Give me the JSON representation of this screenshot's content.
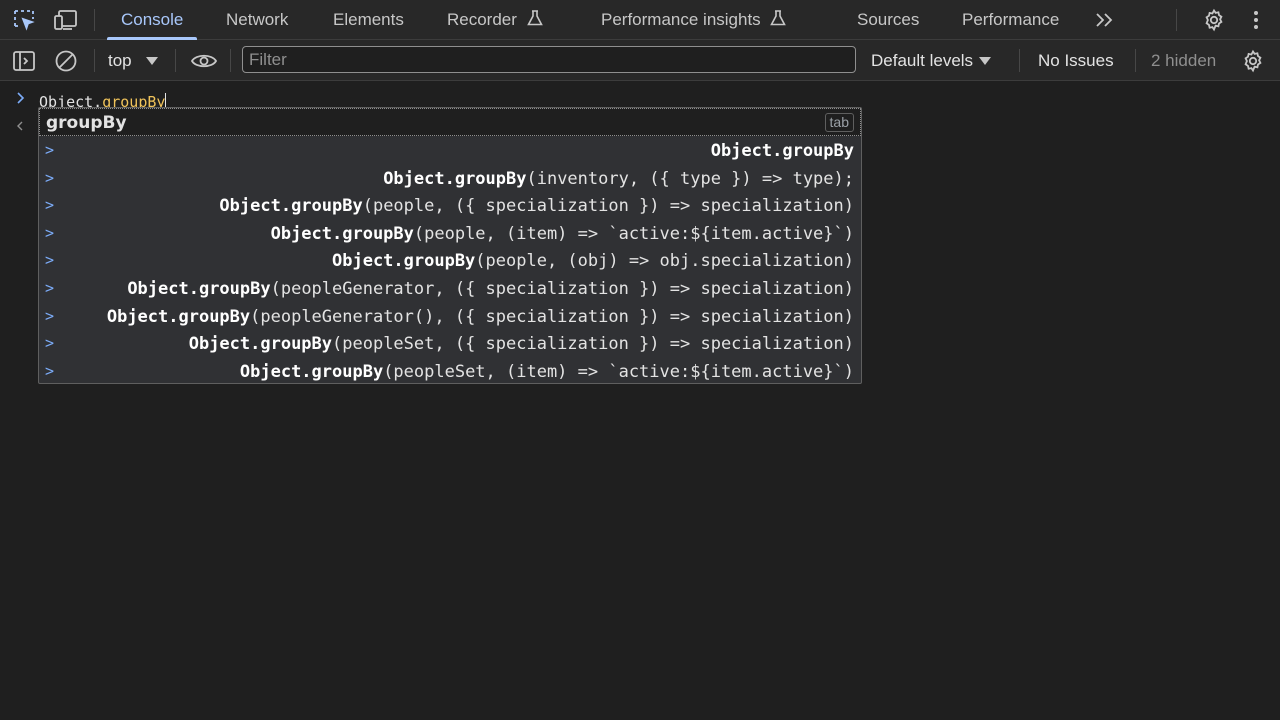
{
  "tabs": [
    {
      "label": "Console",
      "active": true
    },
    {
      "label": "Network"
    },
    {
      "label": "Elements"
    },
    {
      "label": "Recorder"
    },
    {
      "label": "Performance insights"
    },
    {
      "label": "Sources"
    },
    {
      "label": "Performance"
    }
  ],
  "toolbar": {
    "context": "top",
    "filter_placeholder": "Filter",
    "levels": "Default levels",
    "issues": "No Issues",
    "hidden": "2 hidden"
  },
  "console": {
    "input_prefix": "Object.",
    "input_keyword": "groupBy"
  },
  "autocomplete": {
    "header": "groupBy",
    "tab_hint": "tab",
    "arrow": ">",
    "suggestions": [
      {
        "bold": "Object.groupBy",
        "rest": ""
      },
      {
        "bold": "Object.groupBy",
        "rest": "(inventory, ({ type }) => type);"
      },
      {
        "bold": "Object.groupBy",
        "rest": "(people, ({ specialization }) => specialization)"
      },
      {
        "bold": "Object.groupBy",
        "rest": "(people, (item) => `active:${item.active}`)"
      },
      {
        "bold": "Object.groupBy",
        "rest": "(people, (obj) => obj.specialization)"
      },
      {
        "bold": "Object.groupBy",
        "rest": "(peopleGenerator, ({ specialization }) => specialization)"
      },
      {
        "bold": "Object.groupBy",
        "rest": "(peopleGenerator(), ({ specialization }) => specialization)"
      },
      {
        "bold": "Object.groupBy",
        "rest": "(peopleSet, ({ specialization }) => specialization)"
      },
      {
        "bold": "Object.groupBy",
        "rest": "(peopleSet, (item) => `active:${item.active}`)"
      }
    ]
  },
  "colors": {
    "accent": "#a8c7fa",
    "keyword": "#f0c35a",
    "background": "#1f1f1f",
    "toolbar": "#282828"
  },
  "icons": [
    "inspect-element-icon",
    "device-toolbar-icon",
    "flask-icon",
    "more-tabs-icon",
    "settings-gear-icon",
    "kebab-menu-icon",
    "sidebar-toggle-icon",
    "clear-console-icon",
    "dropdown-arrow-icon",
    "eye-icon",
    "prompt-chevron-icon",
    "result-arrow-icon"
  ]
}
